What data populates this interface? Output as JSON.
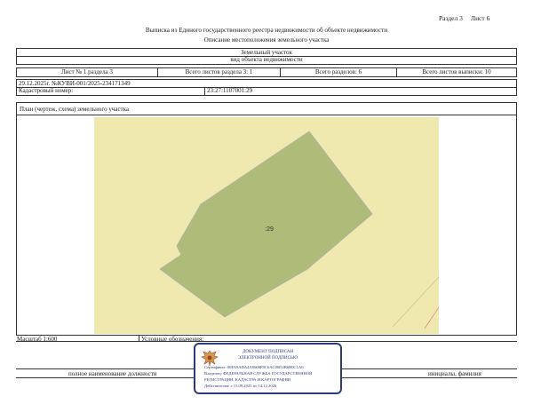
{
  "header": {
    "section_ref": "Раздел 3",
    "sheet_ref": "Лист 6",
    "title": "Выписка из Единого государственного реестра недвижимости об объекте недвижимости",
    "subtitle": "Описание местоположения земельного участка"
  },
  "object": {
    "type": "Земельный участок",
    "type_caption": "вид объекта недвижимости"
  },
  "sheet_info": {
    "sheet": "Лист № 1 раздела 3",
    "total_sheets_section": "Всего листов раздела 3: 1",
    "total_sections": "Всего разделов: 6",
    "total_sheets": "Всего листов выписки: 10"
  },
  "doc_line": "29.12.2025г. №КУВИ-001/2025-234171349",
  "cadastral": {
    "label": "Кадастровый номер:",
    "value": "23:27:1107001:29"
  },
  "plan_title": "План (чертеж, схема) земельного участка",
  "plan": {
    "parcel_label": ":29",
    "fill_color": "#afbb78",
    "background_color": "#efe9b0",
    "boundary_color": "#b0b0b0"
  },
  "footer": {
    "scale": "Масштаб 1:600",
    "legend_label": "Условные обозначения:",
    "position_caption": "полное наименование должности",
    "name_caption": "инициалы, фамилия"
  },
  "stamp": {
    "title_line1": "ДОКУМЕНТ ПОДПИСАН",
    "title_line2": "ЭЛЕКТРОННОЙ ПОДПИСЬЮ",
    "certificate": "Сертификат: 00FA9ADA4A9606F8C6AC00D2B6B0C1A6",
    "owner_line1": "Владелец: ФЕДЕРАЛЬНАЯ СЛУЖБА ГОСУДАРСТВЕННОЙ",
    "owner_line2": "РЕГИСТРАЦИИ, КАДАСТРА И КАРТОГРАФИИ",
    "validity": "Действителен: с 15.09.2025 по 14.12.2026",
    "emblem_icon": "eagle-emblem-icon",
    "color": "#2b3a7a"
  }
}
